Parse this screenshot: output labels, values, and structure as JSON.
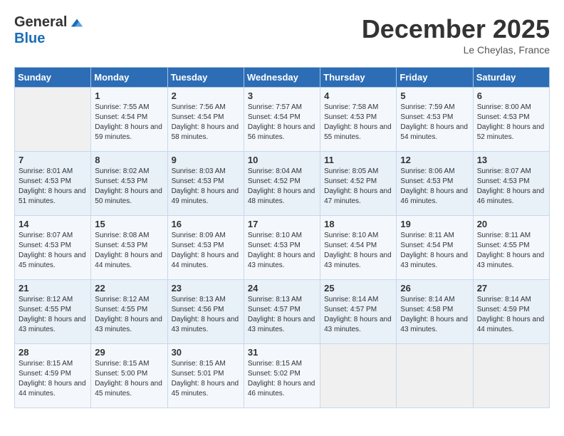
{
  "logo": {
    "general": "General",
    "blue": "Blue"
  },
  "header": {
    "month": "December 2025",
    "location": "Le Cheylas, France"
  },
  "weekdays": [
    "Sunday",
    "Monday",
    "Tuesday",
    "Wednesday",
    "Thursday",
    "Friday",
    "Saturday"
  ],
  "weeks": [
    [
      {
        "day": "",
        "sunrise": "",
        "sunset": "",
        "daylight": ""
      },
      {
        "day": "1",
        "sunrise": "Sunrise: 7:55 AM",
        "sunset": "Sunset: 4:54 PM",
        "daylight": "Daylight: 8 hours and 59 minutes."
      },
      {
        "day": "2",
        "sunrise": "Sunrise: 7:56 AM",
        "sunset": "Sunset: 4:54 PM",
        "daylight": "Daylight: 8 hours and 58 minutes."
      },
      {
        "day": "3",
        "sunrise": "Sunrise: 7:57 AM",
        "sunset": "Sunset: 4:54 PM",
        "daylight": "Daylight: 8 hours and 56 minutes."
      },
      {
        "day": "4",
        "sunrise": "Sunrise: 7:58 AM",
        "sunset": "Sunset: 4:53 PM",
        "daylight": "Daylight: 8 hours and 55 minutes."
      },
      {
        "day": "5",
        "sunrise": "Sunrise: 7:59 AM",
        "sunset": "Sunset: 4:53 PM",
        "daylight": "Daylight: 8 hours and 54 minutes."
      },
      {
        "day": "6",
        "sunrise": "Sunrise: 8:00 AM",
        "sunset": "Sunset: 4:53 PM",
        "daylight": "Daylight: 8 hours and 52 minutes."
      }
    ],
    [
      {
        "day": "7",
        "sunrise": "Sunrise: 8:01 AM",
        "sunset": "Sunset: 4:53 PM",
        "daylight": "Daylight: 8 hours and 51 minutes."
      },
      {
        "day": "8",
        "sunrise": "Sunrise: 8:02 AM",
        "sunset": "Sunset: 4:53 PM",
        "daylight": "Daylight: 8 hours and 50 minutes."
      },
      {
        "day": "9",
        "sunrise": "Sunrise: 8:03 AM",
        "sunset": "Sunset: 4:53 PM",
        "daylight": "Daylight: 8 hours and 49 minutes."
      },
      {
        "day": "10",
        "sunrise": "Sunrise: 8:04 AM",
        "sunset": "Sunset: 4:52 PM",
        "daylight": "Daylight: 8 hours and 48 minutes."
      },
      {
        "day": "11",
        "sunrise": "Sunrise: 8:05 AM",
        "sunset": "Sunset: 4:52 PM",
        "daylight": "Daylight: 8 hours and 47 minutes."
      },
      {
        "day": "12",
        "sunrise": "Sunrise: 8:06 AM",
        "sunset": "Sunset: 4:53 PM",
        "daylight": "Daylight: 8 hours and 46 minutes."
      },
      {
        "day": "13",
        "sunrise": "Sunrise: 8:07 AM",
        "sunset": "Sunset: 4:53 PM",
        "daylight": "Daylight: 8 hours and 46 minutes."
      }
    ],
    [
      {
        "day": "14",
        "sunrise": "Sunrise: 8:07 AM",
        "sunset": "Sunset: 4:53 PM",
        "daylight": "Daylight: 8 hours and 45 minutes."
      },
      {
        "day": "15",
        "sunrise": "Sunrise: 8:08 AM",
        "sunset": "Sunset: 4:53 PM",
        "daylight": "Daylight: 8 hours and 44 minutes."
      },
      {
        "day": "16",
        "sunrise": "Sunrise: 8:09 AM",
        "sunset": "Sunset: 4:53 PM",
        "daylight": "Daylight: 8 hours and 44 minutes."
      },
      {
        "day": "17",
        "sunrise": "Sunrise: 8:10 AM",
        "sunset": "Sunset: 4:53 PM",
        "daylight": "Daylight: 8 hours and 43 minutes."
      },
      {
        "day": "18",
        "sunrise": "Sunrise: 8:10 AM",
        "sunset": "Sunset: 4:54 PM",
        "daylight": "Daylight: 8 hours and 43 minutes."
      },
      {
        "day": "19",
        "sunrise": "Sunrise: 8:11 AM",
        "sunset": "Sunset: 4:54 PM",
        "daylight": "Daylight: 8 hours and 43 minutes."
      },
      {
        "day": "20",
        "sunrise": "Sunrise: 8:11 AM",
        "sunset": "Sunset: 4:55 PM",
        "daylight": "Daylight: 8 hours and 43 minutes."
      }
    ],
    [
      {
        "day": "21",
        "sunrise": "Sunrise: 8:12 AM",
        "sunset": "Sunset: 4:55 PM",
        "daylight": "Daylight: 8 hours and 43 minutes."
      },
      {
        "day": "22",
        "sunrise": "Sunrise: 8:12 AM",
        "sunset": "Sunset: 4:55 PM",
        "daylight": "Daylight: 8 hours and 43 minutes."
      },
      {
        "day": "23",
        "sunrise": "Sunrise: 8:13 AM",
        "sunset": "Sunset: 4:56 PM",
        "daylight": "Daylight: 8 hours and 43 minutes."
      },
      {
        "day": "24",
        "sunrise": "Sunrise: 8:13 AM",
        "sunset": "Sunset: 4:57 PM",
        "daylight": "Daylight: 8 hours and 43 minutes."
      },
      {
        "day": "25",
        "sunrise": "Sunrise: 8:14 AM",
        "sunset": "Sunset: 4:57 PM",
        "daylight": "Daylight: 8 hours and 43 minutes."
      },
      {
        "day": "26",
        "sunrise": "Sunrise: 8:14 AM",
        "sunset": "Sunset: 4:58 PM",
        "daylight": "Daylight: 8 hours and 43 minutes."
      },
      {
        "day": "27",
        "sunrise": "Sunrise: 8:14 AM",
        "sunset": "Sunset: 4:59 PM",
        "daylight": "Daylight: 8 hours and 44 minutes."
      }
    ],
    [
      {
        "day": "28",
        "sunrise": "Sunrise: 8:15 AM",
        "sunset": "Sunset: 4:59 PM",
        "daylight": "Daylight: 8 hours and 44 minutes."
      },
      {
        "day": "29",
        "sunrise": "Sunrise: 8:15 AM",
        "sunset": "Sunset: 5:00 PM",
        "daylight": "Daylight: 8 hours and 45 minutes."
      },
      {
        "day": "30",
        "sunrise": "Sunrise: 8:15 AM",
        "sunset": "Sunset: 5:01 PM",
        "daylight": "Daylight: 8 hours and 45 minutes."
      },
      {
        "day": "31",
        "sunrise": "Sunrise: 8:15 AM",
        "sunset": "Sunset: 5:02 PM",
        "daylight": "Daylight: 8 hours and 46 minutes."
      },
      {
        "day": "",
        "sunrise": "",
        "sunset": "",
        "daylight": ""
      },
      {
        "day": "",
        "sunrise": "",
        "sunset": "",
        "daylight": ""
      },
      {
        "day": "",
        "sunrise": "",
        "sunset": "",
        "daylight": ""
      }
    ]
  ]
}
